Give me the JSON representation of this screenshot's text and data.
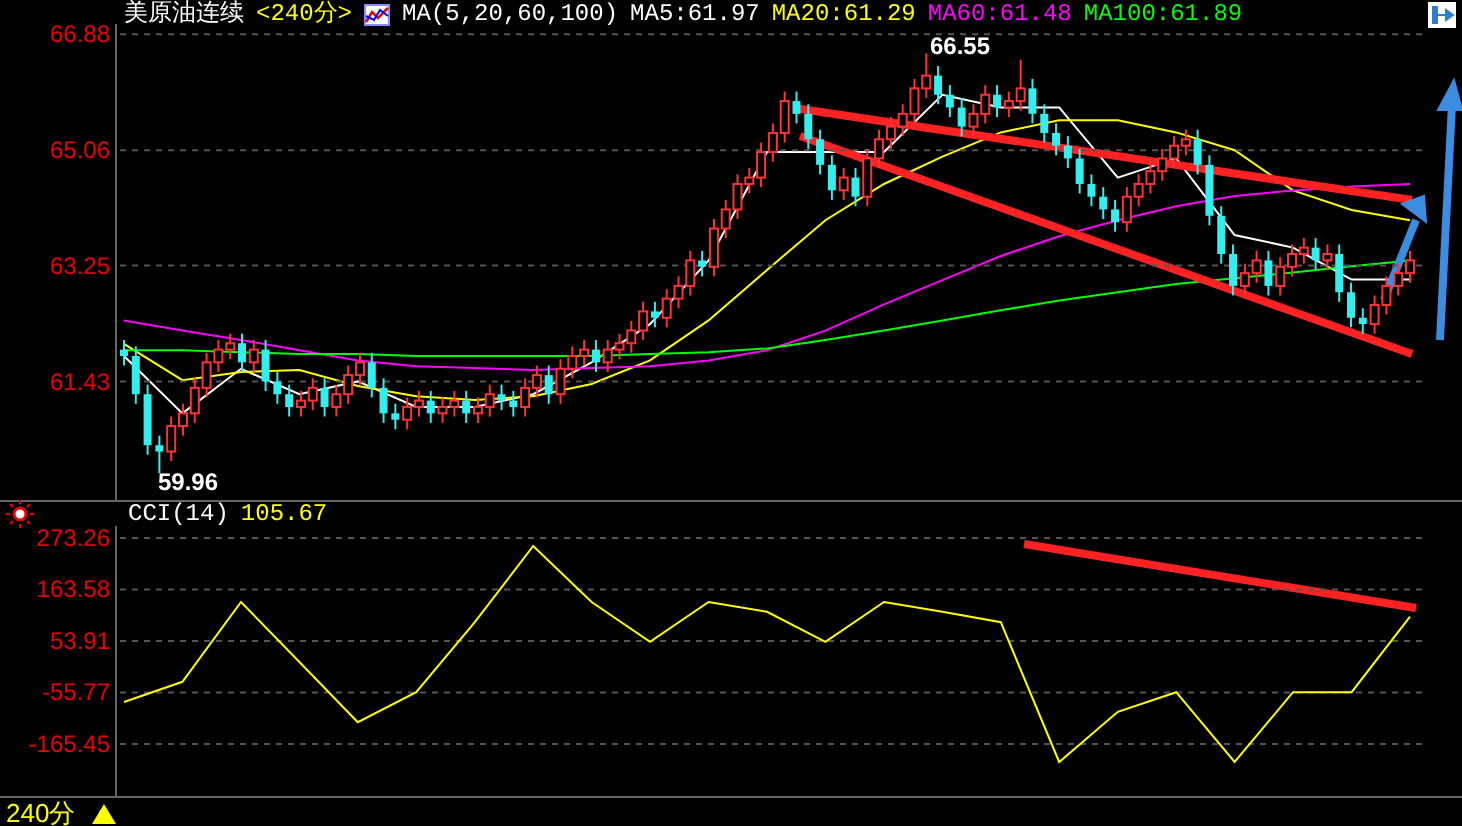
{
  "header": {
    "title": "美原油连续",
    "period": "<240分>",
    "indicator": "MA(5,20,60,100)",
    "ma_values": [
      {
        "label": "MA5:61.97",
        "color": "#ffffff"
      },
      {
        "label": "MA20:61.29",
        "color": "#ffff00"
      },
      {
        "label": "MA60:61.48",
        "color": "#ff00ff"
      },
      {
        "label": "MA100:61.89",
        "color": "#00ff00"
      }
    ]
  },
  "price_chart": {
    "chart_data": {
      "type": "candlestick",
      "grid": true,
      "ylim": [
        59.54,
        67.01
      ],
      "yticks": [
        66.88,
        65.06,
        63.25,
        61.43
      ],
      "ohlc": [
        [
          61.9,
          62.05,
          61.65,
          61.8
        ],
        [
          61.8,
          61.95,
          61.05,
          61.2
        ],
        [
          61.2,
          61.35,
          60.25,
          60.4
        ],
        [
          60.4,
          60.55,
          59.96,
          60.3
        ],
        [
          60.3,
          60.85,
          60.15,
          60.7
        ],
        [
          60.7,
          61.05,
          60.55,
          60.9
        ],
        [
          60.9,
          61.45,
          60.75,
          61.3
        ],
        [
          61.3,
          61.85,
          61.15,
          61.7
        ],
        [
          61.7,
          62.05,
          61.55,
          61.9
        ],
        [
          61.9,
          62.15,
          61.75,
          62.0
        ],
        [
          62.0,
          62.15,
          61.55,
          61.7
        ],
        [
          61.7,
          62.05,
          61.55,
          61.9
        ],
        [
          61.9,
          62.05,
          61.25,
          61.4
        ],
        [
          61.4,
          61.55,
          61.05,
          61.2
        ],
        [
          61.2,
          61.35,
          60.85,
          61.0
        ],
        [
          61.0,
          61.25,
          60.85,
          61.1
        ],
        [
          61.1,
          61.45,
          60.95,
          61.3
        ],
        [
          61.3,
          61.45,
          60.85,
          61.0
        ],
        [
          61.0,
          61.35,
          60.85,
          61.2
        ],
        [
          61.2,
          61.65,
          61.05,
          61.5
        ],
        [
          61.5,
          61.85,
          61.35,
          61.7
        ],
        [
          61.7,
          61.85,
          61.15,
          61.3
        ],
        [
          61.3,
          61.45,
          60.75,
          60.9
        ],
        [
          60.9,
          61.05,
          60.65,
          60.8
        ],
        [
          60.8,
          61.15,
          60.65,
          61.0
        ],
        [
          61.0,
          61.25,
          60.85,
          61.1
        ],
        [
          61.1,
          61.25,
          60.75,
          60.9
        ],
        [
          60.9,
          61.15,
          60.75,
          61.0
        ],
        [
          61.0,
          61.25,
          60.85,
          61.1
        ],
        [
          61.1,
          61.25,
          60.75,
          60.9
        ],
        [
          60.9,
          61.15,
          60.75,
          61.0
        ],
        [
          61.0,
          61.35,
          60.85,
          61.2
        ],
        [
          61.2,
          61.35,
          60.95,
          61.1
        ],
        [
          61.1,
          61.25,
          60.85,
          61.0
        ],
        [
          61.0,
          61.45,
          60.85,
          61.3
        ],
        [
          61.3,
          61.65,
          61.15,
          61.5
        ],
        [
          61.5,
          61.65,
          61.05,
          61.2
        ],
        [
          61.2,
          61.75,
          61.05,
          61.6
        ],
        [
          61.6,
          61.95,
          61.45,
          61.8
        ],
        [
          61.8,
          62.05,
          61.65,
          61.9
        ],
        [
          61.9,
          62.05,
          61.55,
          61.7
        ],
        [
          61.7,
          62.05,
          61.55,
          61.9
        ],
        [
          61.9,
          62.15,
          61.75,
          62.0
        ],
        [
          62.0,
          62.35,
          61.85,
          62.2
        ],
        [
          62.2,
          62.65,
          62.05,
          62.5
        ],
        [
          62.5,
          62.65,
          62.25,
          62.4
        ],
        [
          62.4,
          62.85,
          62.25,
          62.7
        ],
        [
          62.7,
          63.05,
          62.55,
          62.9
        ],
        [
          62.9,
          63.45,
          62.75,
          63.3
        ],
        [
          63.3,
          63.45,
          63.05,
          63.2
        ],
        [
          63.2,
          63.95,
          63.05,
          63.8
        ],
        [
          63.8,
          64.25,
          63.65,
          64.1
        ],
        [
          64.1,
          64.65,
          63.95,
          64.5
        ],
        [
          64.5,
          64.75,
          64.35,
          64.6
        ],
        [
          64.6,
          65.15,
          64.45,
          65.0
        ],
        [
          65.0,
          65.45,
          64.85,
          65.3
        ],
        [
          65.3,
          65.95,
          65.15,
          65.8
        ],
        [
          65.8,
          65.95,
          65.45,
          65.6
        ],
        [
          65.6,
          65.75,
          65.05,
          65.2
        ],
        [
          65.2,
          65.35,
          64.65,
          64.8
        ],
        [
          64.8,
          64.95,
          64.25,
          64.4
        ],
        [
          64.4,
          64.75,
          64.25,
          64.6
        ],
        [
          64.6,
          64.75,
          64.15,
          64.3
        ],
        [
          64.3,
          65.05,
          64.15,
          64.9
        ],
        [
          64.9,
          65.35,
          64.75,
          65.2
        ],
        [
          65.2,
          65.55,
          65.05,
          65.4
        ],
        [
          65.4,
          65.75,
          65.25,
          65.6
        ],
        [
          65.6,
          66.15,
          65.45,
          66.0
        ],
        [
          66.0,
          66.55,
          65.85,
          66.2
        ],
        [
          66.2,
          66.35,
          65.75,
          65.9
        ],
        [
          65.9,
          66.05,
          65.55,
          65.7
        ],
        [
          65.7,
          65.85,
          65.25,
          65.4
        ],
        [
          65.4,
          65.75,
          65.25,
          65.6
        ],
        [
          65.6,
          66.05,
          65.45,
          65.9
        ],
        [
          65.9,
          66.05,
          65.55,
          65.7
        ],
        [
          65.7,
          65.95,
          65.55,
          65.8
        ],
        [
          65.8,
          66.45,
          65.65,
          66.0
        ],
        [
          66.0,
          66.15,
          65.45,
          65.6
        ],
        [
          65.6,
          65.75,
          65.15,
          65.3
        ],
        [
          65.3,
          65.45,
          64.95,
          65.1
        ],
        [
          65.1,
          65.25,
          64.75,
          64.9
        ],
        [
          64.9,
          65.05,
          64.35,
          64.5
        ],
        [
          64.5,
          64.65,
          64.15,
          64.3
        ],
        [
          64.3,
          64.45,
          63.95,
          64.1
        ],
        [
          64.1,
          64.25,
          63.75,
          63.9
        ],
        [
          63.9,
          64.45,
          63.75,
          64.3
        ],
        [
          64.3,
          64.65,
          64.15,
          64.5
        ],
        [
          64.5,
          64.85,
          64.35,
          64.7
        ],
        [
          64.7,
          65.05,
          64.55,
          64.9
        ],
        [
          64.9,
          65.25,
          64.75,
          65.1
        ],
        [
          65.1,
          65.35,
          64.95,
          65.2
        ],
        [
          65.2,
          65.35,
          64.65,
          64.8
        ],
        [
          64.8,
          64.95,
          63.85,
          64.0
        ],
        [
          64.0,
          64.15,
          63.25,
          63.4
        ],
        [
          63.4,
          63.55,
          62.75,
          62.9
        ],
        [
          62.9,
          63.25,
          62.75,
          63.1
        ],
        [
          63.1,
          63.45,
          62.95,
          63.3
        ],
        [
          63.3,
          63.45,
          62.75,
          62.9
        ],
        [
          62.9,
          63.35,
          62.75,
          63.2
        ],
        [
          63.2,
          63.55,
          63.05,
          63.4
        ],
        [
          63.4,
          63.65,
          63.25,
          63.5
        ],
        [
          63.5,
          63.65,
          63.15,
          63.3
        ],
        [
          63.3,
          63.55,
          63.15,
          63.4
        ],
        [
          63.4,
          63.55,
          62.65,
          62.8
        ],
        [
          62.8,
          62.95,
          62.25,
          62.4
        ],
        [
          62.4,
          62.55,
          62.15,
          62.3
        ],
        [
          62.3,
          62.75,
          62.15,
          62.6
        ],
        [
          62.6,
          63.05,
          62.45,
          62.9
        ],
        [
          62.9,
          63.25,
          62.75,
          63.1
        ],
        [
          63.1,
          63.45,
          62.95,
          63.3
        ]
      ]
    },
    "ma_lines": {
      "chart_data": {
        "type": "line",
        "ylim": [
          59.54,
          67.01
        ],
        "series": [
          {
            "color": "#ffffff",
            "values": [
              61.8,
              60.9,
              61.6,
              61.2,
              61.4,
              61.0,
              61.0,
              61.2,
              61.7,
              62.3,
              63.3,
              65.0,
              65.0,
              65.0,
              65.9,
              65.7,
              65.7,
              64.6,
              64.9,
              63.7,
              63.5,
              63.0,
              63.0
            ]
          },
          {
            "color": "#ffff00",
            "values": [
              61.99,
              61.42,
              61.55,
              61.58,
              61.33,
              61.17,
              61.11,
              61.17,
              61.36,
              61.73,
              62.36,
              63.15,
              63.93,
              64.5,
              64.93,
              65.31,
              65.5,
              65.5,
              65.31,
              65.03,
              64.4,
              64.09,
              63.93
            ]
          },
          {
            "color": "#ff00ff",
            "values": [
              62.36,
              62.2,
              62.05,
              61.89,
              61.73,
              61.64,
              61.61,
              61.58,
              61.61,
              61.64,
              61.73,
              61.89,
              62.2,
              62.61,
              62.99,
              63.37,
              63.68,
              63.93,
              64.15,
              64.31,
              64.4,
              64.46,
              64.5
            ]
          },
          {
            "color": "#00ff00",
            "values": [
              61.89,
              61.89,
              61.86,
              61.83,
              61.83,
              61.8,
              61.8,
              61.8,
              61.8,
              61.83,
              61.86,
              61.92,
              62.05,
              62.2,
              62.36,
              62.52,
              62.67,
              62.8,
              62.93,
              63.02,
              63.11,
              63.21,
              63.3
            ]
          }
        ]
      }
    },
    "annotations": {
      "high": "66.55",
      "low": "59.96"
    }
  },
  "cci": {
    "label": "CCI(14)",
    "value": "105.67",
    "chart_data": {
      "type": "line",
      "grid": true,
      "ylim": [
        -276.2,
        298.8
      ],
      "yticks": [
        273.26,
        163.58,
        53.91,
        -55.77,
        -165.45
      ],
      "series": [
        {
          "color": "#ffff00",
          "values": [
            -76,
            -33,
            137,
            9,
            -119,
            -55,
            94,
            256,
            137,
            52,
            137,
            116,
            52,
            137,
            116,
            94,
            -204,
            -97,
            -55,
            -204,
            -55,
            -55,
            106
          ]
        }
      ]
    }
  },
  "footer": {
    "period": "240分"
  }
}
